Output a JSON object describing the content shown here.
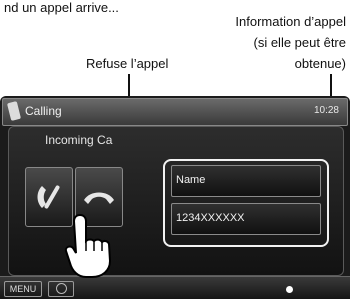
{
  "document": {
    "intro_text": "nd un appel arrive...",
    "info_label_line1": "Information d’appel",
    "info_label_line2": "(si elle peut être",
    "info_label_line3": "obtenue)",
    "refuse_label": "Refuse l’appel"
  },
  "screen": {
    "title": "Calling",
    "clock": "10:28",
    "panel_heading": "Incoming Ca",
    "name_value": "Name",
    "number_value": "1234XXXXXX",
    "menu_label": "MENU"
  },
  "colors": {
    "screen_bg": "#1b1b1b",
    "highlight": "#f2f2f2"
  },
  "icons": [
    "phone-answer-icon",
    "phone-hangup-icon",
    "eject-icon",
    "hand-pointer-icon"
  ]
}
